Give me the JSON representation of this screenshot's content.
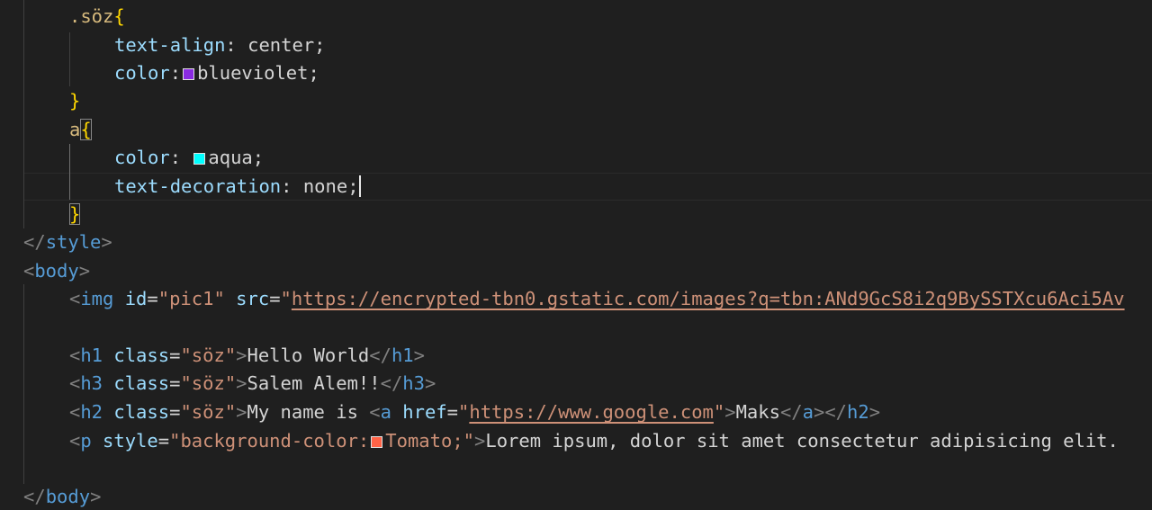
{
  "colors": {
    "blueviolet": "#8a2be2",
    "aqua": "#00ffff",
    "tomato": "#ff6347"
  },
  "css": {
    "rule1": {
      "selector": ".söz",
      "prop1": "text-align",
      "val1": "center",
      "prop2": "color",
      "val2": "blueviolet"
    },
    "rule2": {
      "selector": "a",
      "prop1": "color",
      "val1": "aqua",
      "prop2": "text-decoration",
      "val2": "none"
    }
  },
  "html": {
    "style_close": "style",
    "body_open": "body",
    "body_close": "body",
    "img": {
      "tag": "img",
      "attr_id": "id",
      "id_val": "pic1",
      "attr_src": "src",
      "src_val": "https://encrypted-tbn0.gstatic.com/images?q=tbn:ANd9GcS8i2q9BySSTXcu6Aci5Av"
    },
    "h1": {
      "tag": "h1",
      "attr": "class",
      "class_val": "söz",
      "text": "Hello World"
    },
    "h3": {
      "tag": "h3",
      "attr": "class",
      "class_val": "söz",
      "text": "Salem Alem!!"
    },
    "h2": {
      "tag": "h2",
      "attr": "class",
      "class_val": "söz",
      "text": "My name is ",
      "a_tag": "a",
      "a_attr": "href",
      "a_href": "https://www.google.com",
      "a_text": "Maks"
    },
    "p": {
      "tag": "p",
      "attr": "style",
      "style_prop": "background-color:",
      "style_val": "Tomato;",
      "text": "Lorem ipsum, dolor sit amet consectetur adipisicing elit."
    }
  }
}
